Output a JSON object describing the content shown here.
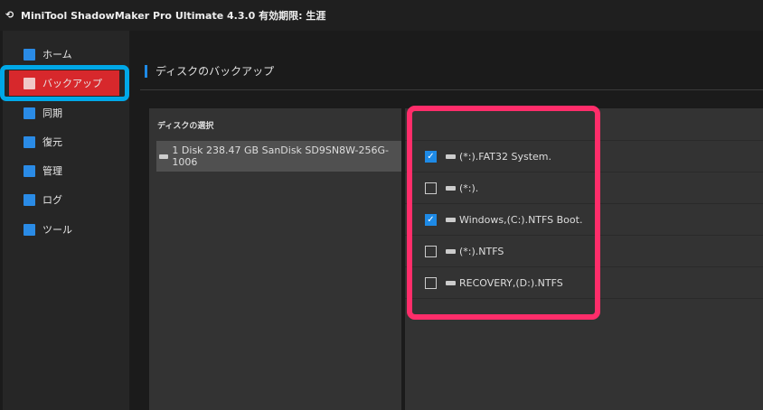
{
  "title_bar": {
    "title": "MiniTool ShadowMaker Pro Ultimate 4.3.0 有効期限: 生涯"
  },
  "sidebar": {
    "items": [
      {
        "label": "ホーム",
        "icon": "home-icon"
      },
      {
        "label": "バックアップ",
        "icon": "backup-icon",
        "active": true
      },
      {
        "label": "同期",
        "icon": "sync-icon"
      },
      {
        "label": "復元",
        "icon": "restore-icon"
      },
      {
        "label": "管理",
        "icon": "manage-icon"
      },
      {
        "label": "ログ",
        "icon": "log-icon"
      },
      {
        "label": "ツール",
        "icon": "tools-icon"
      }
    ]
  },
  "main": {
    "heading": "ディスクのバックアップ",
    "disk_select": {
      "title": "ディスクの選択",
      "disk": "1 Disk 238.47 GB SanDisk SD9SN8W-256G-1006"
    },
    "partitions": [
      {
        "label": "(*:).FAT32 System.",
        "checked": true
      },
      {
        "label": "(*:).",
        "checked": false
      },
      {
        "label": "Windows,(C:).NTFS Boot.",
        "checked": true
      },
      {
        "label": "(*:).NTFS",
        "checked": false
      },
      {
        "label": "RECOVERY,(D:).NTFS",
        "checked": false
      }
    ]
  },
  "colors": {
    "accent": "#1e8ae6",
    "active": "#d7282c",
    "highlight_blue": "#00a8e8",
    "highlight_pink": "#ff2d6a"
  }
}
